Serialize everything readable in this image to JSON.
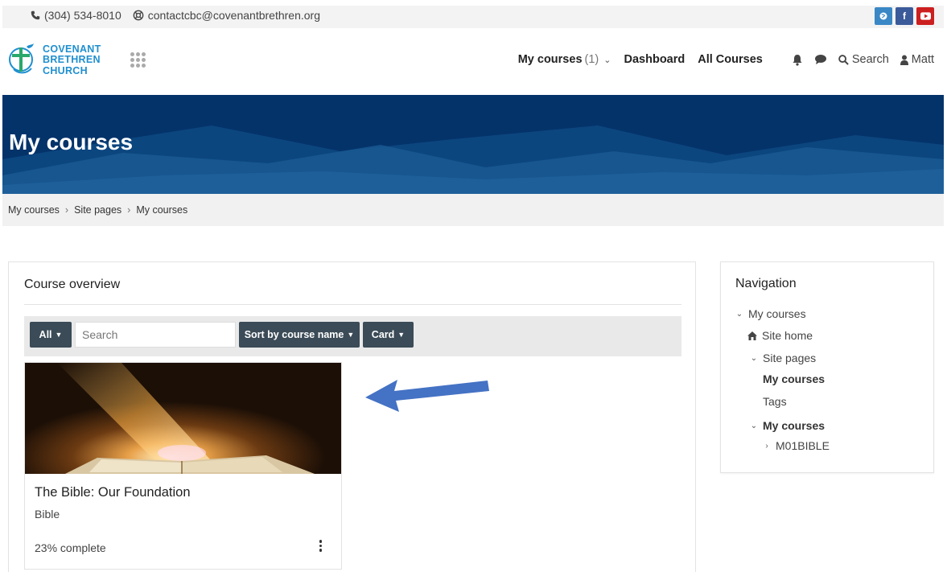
{
  "topbar": {
    "phone": "(304) 534-8010",
    "email": "contactcbc@covenantbrethren.org",
    "social": [
      {
        "icon": "globe-icon",
        "color": "#3a87c5"
      },
      {
        "icon": "facebook-icon",
        "label": "f",
        "color": "#3b5a9a"
      },
      {
        "icon": "youtube-icon",
        "color": "#cc1f1f"
      }
    ]
  },
  "header": {
    "logo_lines": [
      "COVENANT",
      "BRETHREN",
      "CHURCH"
    ],
    "nav": {
      "my_courses": "My courses",
      "my_courses_count": "(1)",
      "dashboard": "Dashboard",
      "all_courses": "All Courses",
      "search": "Search",
      "user": "Matt"
    }
  },
  "hero": {
    "title": "My courses"
  },
  "breadcrumb": [
    "My courses",
    "Site pages",
    "My courses"
  ],
  "overview": {
    "title": "Course overview",
    "filter_all": "All",
    "search_placeholder": "Search",
    "sort_label": "Sort by course name",
    "view_label": "Card",
    "course": {
      "title": "The Bible: Our Foundation",
      "category": "Bible",
      "progress_text": "23% complete",
      "progress": 0.23
    }
  },
  "navigation": {
    "title": "Navigation",
    "items": [
      {
        "label": "My courses"
      },
      {
        "label": "Site home"
      },
      {
        "label": "Site pages"
      },
      {
        "label": "My courses"
      },
      {
        "label": "Tags"
      },
      {
        "label": "My courses"
      },
      {
        "label": "M01BIBLE"
      }
    ]
  },
  "colors": {
    "brand": "#1f8fcf",
    "hero": "#04336a",
    "button": "#3b4b57",
    "arrow": "#4472c4"
  }
}
